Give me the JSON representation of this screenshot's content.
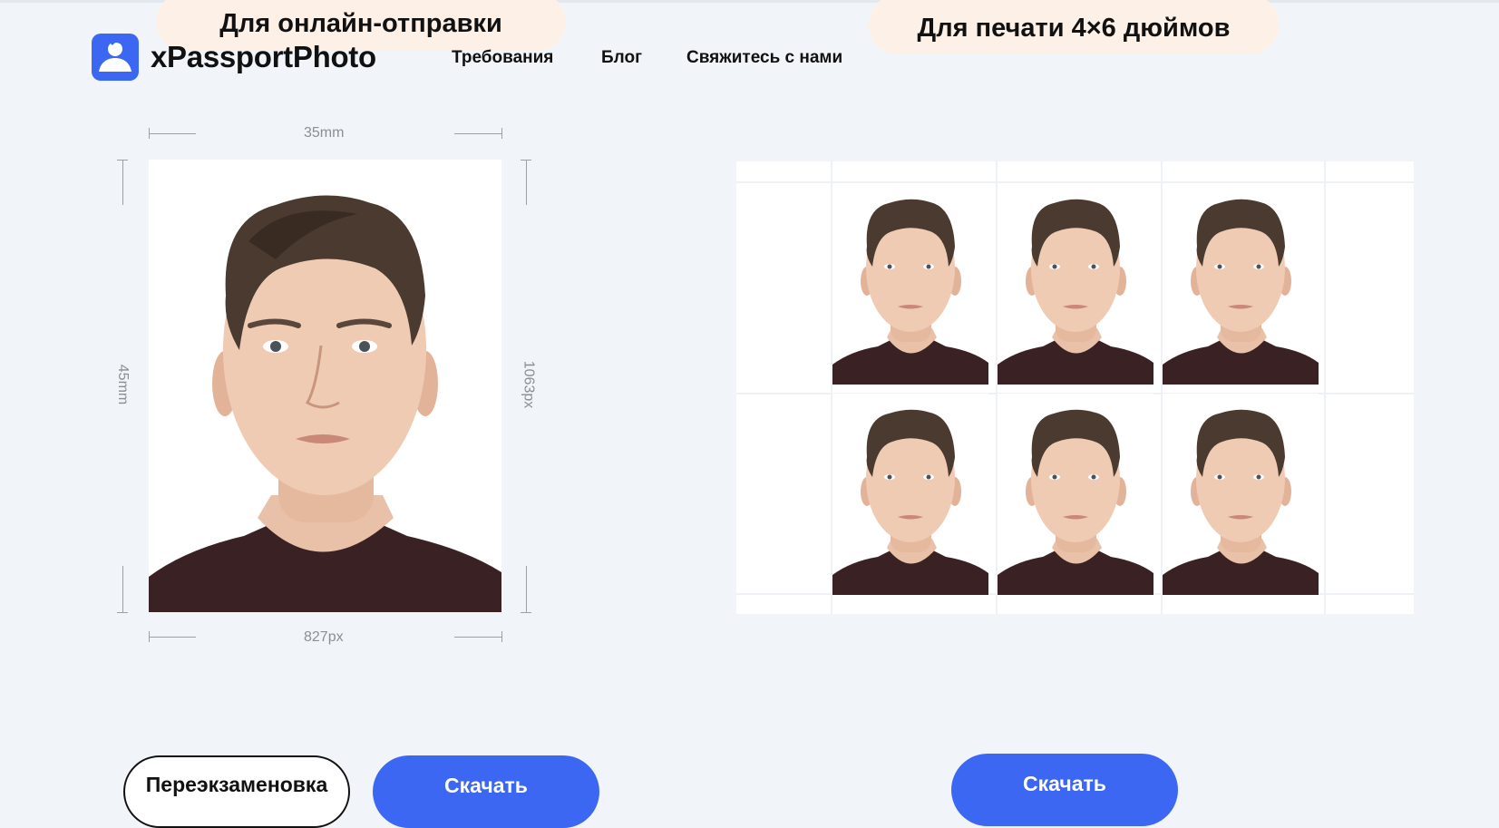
{
  "tags": {
    "online": "Для онлайн-отправки",
    "print": "Для печати 4×6 дюймов"
  },
  "brand": {
    "name": "xPassportPhoto",
    "logo_icon": "user-avatar-icon",
    "accent": "#3c67f2"
  },
  "nav": {
    "items": [
      "Требования",
      "Блог",
      "Свяжитесь с нами"
    ]
  },
  "photo": {
    "width_mm": "35mm",
    "height_mm": "45mm",
    "width_px": "827px",
    "height_px": "1063px"
  },
  "sheet": {
    "copies": 6
  },
  "buttons": {
    "retake": "Переэкзаменовка",
    "download_single": "Скачать",
    "download_sheet": "Скачать"
  },
  "colors": {
    "background": "#f1f5fa",
    "tag_bg": "#fdf0e6",
    "button_primary": "#3c67f2"
  }
}
